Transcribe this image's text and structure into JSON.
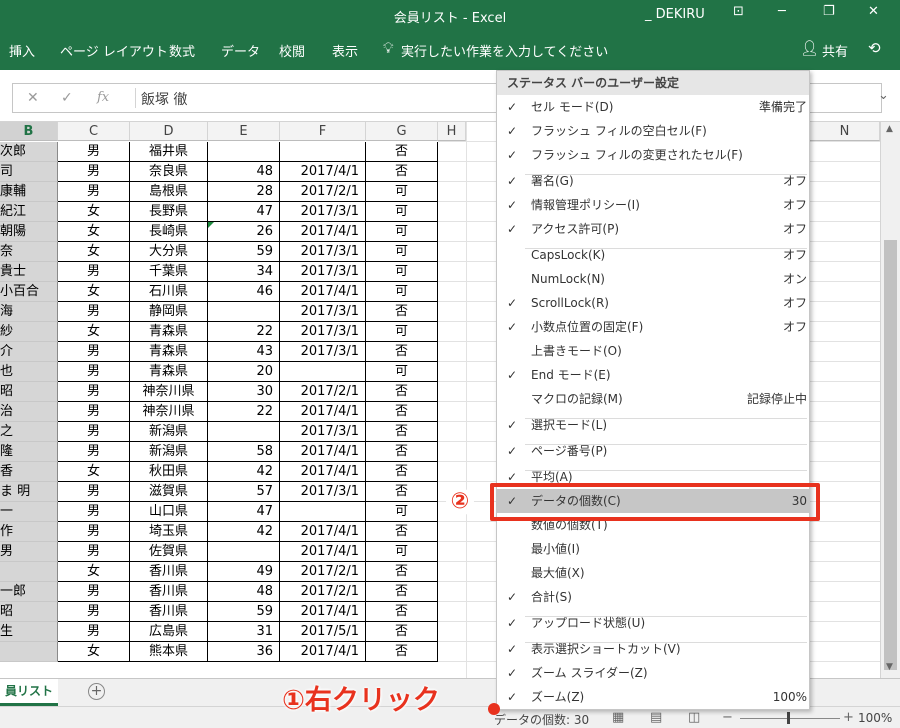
{
  "titlebar": {
    "title": "会員リスト  -  Excel",
    "user": "_ DEKIRU",
    "controls": [
      "⊡",
      "─",
      "❐",
      "✕"
    ]
  },
  "ribbon": {
    "tabs": [
      "挿入",
      "ページ レイアウト",
      "数式",
      "データ",
      "校閲",
      "表示"
    ],
    "tell_me": "実行したい作業を入力してください",
    "share": "共有"
  },
  "formula_bar": {
    "cancel": "✕",
    "enter": "✓",
    "fx": "fx",
    "value": "飯塚 徹"
  },
  "columns": [
    "B",
    "C",
    "D",
    "E",
    "F",
    "G",
    "H",
    "N"
  ],
  "rows": [
    [
      "次郎",
      "男",
      "福井県",
      "",
      "",
      "否"
    ],
    [
      "司",
      "男",
      "奈良県",
      "48",
      "2017/4/1",
      "否"
    ],
    [
      "康輔",
      "男",
      "島根県",
      "28",
      "2017/2/1",
      "可"
    ],
    [
      "紀江",
      "女",
      "長野県",
      "47",
      "2017/3/1",
      "可"
    ],
    [
      "朝陽",
      "女",
      "長崎県",
      "26",
      "2017/4/1",
      "可"
    ],
    [
      "奈",
      "女",
      "大分県",
      "59",
      "2017/3/1",
      "可"
    ],
    [
      "貴士",
      "男",
      "千葉県",
      "34",
      "2017/3/1",
      "可"
    ],
    [
      "小百合",
      "女",
      "石川県",
      "46",
      "2017/4/1",
      "可"
    ],
    [
      "海",
      "男",
      "静岡県",
      "",
      "2017/3/1",
      "否"
    ],
    [
      "紗",
      "女",
      "青森県",
      "22",
      "2017/3/1",
      "可"
    ],
    [
      "介",
      "男",
      "青森県",
      "43",
      "2017/3/1",
      "否"
    ],
    [
      "也",
      "男",
      "青森県",
      "20",
      "",
      "可"
    ],
    [
      "昭",
      "男",
      "神奈川県",
      "30",
      "2017/2/1",
      "否"
    ],
    [
      "治",
      "男",
      "神奈川県",
      "22",
      "2017/4/1",
      "否"
    ],
    [
      "之",
      "男",
      "新潟県",
      "",
      "2017/3/1",
      "否"
    ],
    [
      "隆",
      "男",
      "新潟県",
      "58",
      "2017/4/1",
      "否"
    ],
    [
      "香",
      "女",
      "秋田県",
      "42",
      "2017/4/1",
      "否"
    ],
    [
      "ま 明",
      "男",
      "滋賀県",
      "57",
      "2017/3/1",
      "否"
    ],
    [
      "一",
      "男",
      "山口県",
      "47",
      "",
      "可"
    ],
    [
      "作",
      "男",
      "埼玉県",
      "42",
      "2017/4/1",
      "否"
    ],
    [
      "男",
      "男",
      "佐賀県",
      "",
      "2017/4/1",
      "可"
    ],
    [
      "",
      "女",
      "香川県",
      "49",
      "2017/2/1",
      "否"
    ],
    [
      "一郎",
      "男",
      "香川県",
      "48",
      "2017/2/1",
      "否"
    ],
    [
      "昭",
      "男",
      "香川県",
      "59",
      "2017/4/1",
      "否"
    ],
    [
      "生",
      "男",
      "広島県",
      "31",
      "2017/5/1",
      "否"
    ],
    [
      "",
      "女",
      "熊本県",
      "36",
      "2017/4/1",
      "否"
    ]
  ],
  "context_menu": {
    "header": "ステータス バーのユーザー設定",
    "items": [
      {
        "label": "セル モード(D)",
        "checked": true,
        "value": "準備完了"
      },
      {
        "label": "フラッシュ フィルの空白セル(F)",
        "checked": true,
        "value": ""
      },
      {
        "label": "フラッシュ フィルの変更されたセル(F)",
        "checked": true,
        "value": ""
      },
      {
        "label": "署名(G)",
        "checked": true,
        "value": "オフ"
      },
      {
        "label": "情報管理ポリシー(I)",
        "checked": true,
        "value": "オフ"
      },
      {
        "label": "アクセス許可(P)",
        "checked": true,
        "value": "オフ"
      },
      {
        "label": "CapsLock(K)",
        "checked": false,
        "value": "オフ"
      },
      {
        "label": "NumLock(N)",
        "checked": false,
        "value": "オン"
      },
      {
        "label": "ScrollLock(R)",
        "checked": true,
        "value": "オフ"
      },
      {
        "label": "小数点位置の固定(F)",
        "checked": true,
        "value": "オフ"
      },
      {
        "label": "上書きモード(O)",
        "checked": false,
        "value": ""
      },
      {
        "label": "End モード(E)",
        "checked": true,
        "value": ""
      },
      {
        "label": "マクロの記録(M)",
        "checked": false,
        "value": "記録停止中"
      },
      {
        "label": "選択モード(L)",
        "checked": true,
        "value": ""
      },
      {
        "label": "ページ番号(P)",
        "checked": true,
        "value": ""
      },
      {
        "label": "平均(A)",
        "checked": true,
        "value": ""
      },
      {
        "label": "データの個数(C)",
        "checked": true,
        "value": "30"
      },
      {
        "label": "数値の個数(T)",
        "checked": false,
        "value": ""
      },
      {
        "label": "最小値(I)",
        "checked": false,
        "value": ""
      },
      {
        "label": "最大値(X)",
        "checked": false,
        "value": ""
      },
      {
        "label": "合計(S)",
        "checked": true,
        "value": ""
      },
      {
        "label": "アップロード状態(U)",
        "checked": true,
        "value": ""
      },
      {
        "label": "表示選択ショートカット(V)",
        "checked": true,
        "value": ""
      },
      {
        "label": "ズーム スライダー(Z)",
        "checked": true,
        "value": ""
      },
      {
        "label": "ズーム(Z)",
        "checked": true,
        "value": "100%"
      }
    ]
  },
  "sheet_tab": "員リスト",
  "add_sheet": "+",
  "status_bar": {
    "count": "データの個数: 30",
    "zoom": "100%"
  },
  "annotations": {
    "step1": "①右クリック",
    "step2": "②"
  },
  "colors": {
    "excel_green": "#217346",
    "highlight_red": "#e8321e"
  }
}
